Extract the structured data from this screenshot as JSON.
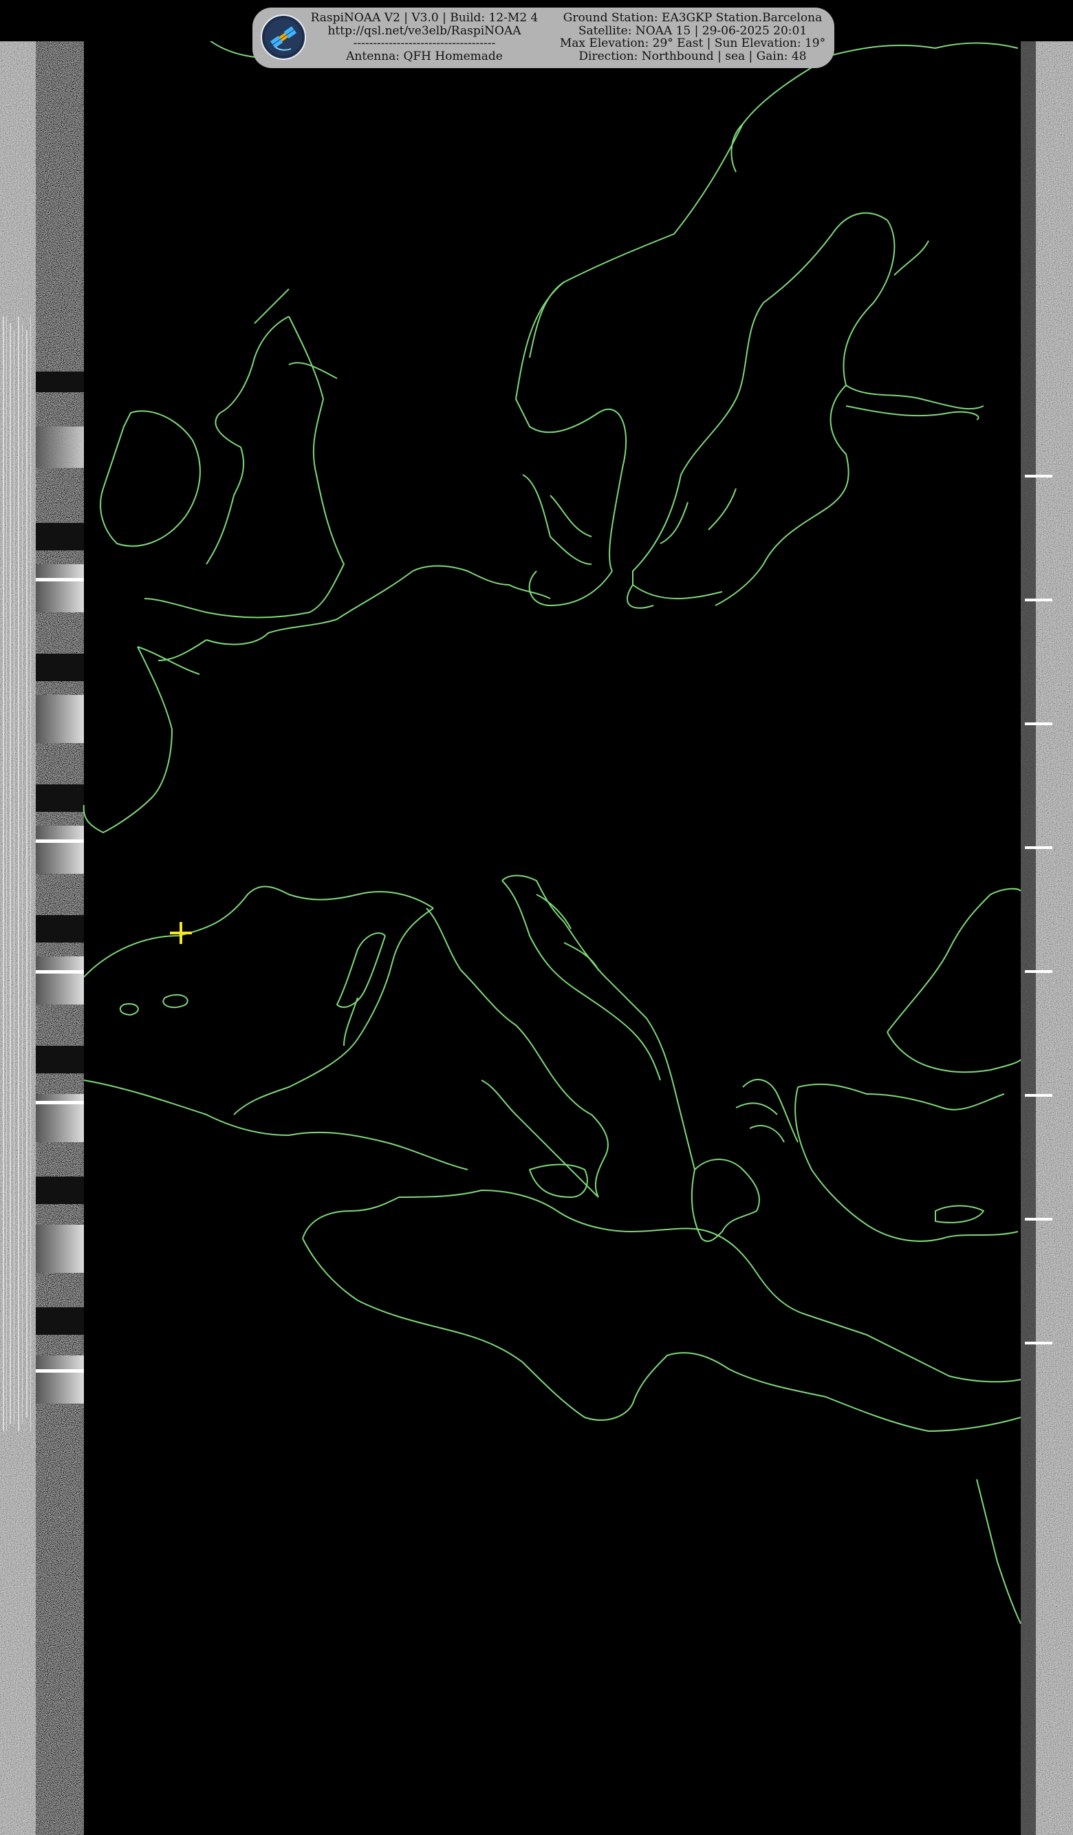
{
  "header": {
    "left_lines": [
      "RaspiNOAA V2 | V3.0 | Build: 12-M2 4",
      "http://qsl.net/ve3elb/RaspiNOAA",
      "------------------------------------",
      "Antenna: QFH Homemade"
    ],
    "right_lines": [
      "Ground Station: EA3GKP Station.Barcelona",
      "Satellite: NOAA 15 | 29-06-2025 20:01",
      "Max Elevation: 29° East | Sun Elevation: 19°",
      "Direction: Northbound | sea | Gain: 48"
    ]
  },
  "image": {
    "kind": "APT weather satellite image with coastline overlay",
    "coastline_color": "#7fd97a",
    "marker_color": "#f5e61e",
    "marker": "ground-station-crosshair"
  }
}
